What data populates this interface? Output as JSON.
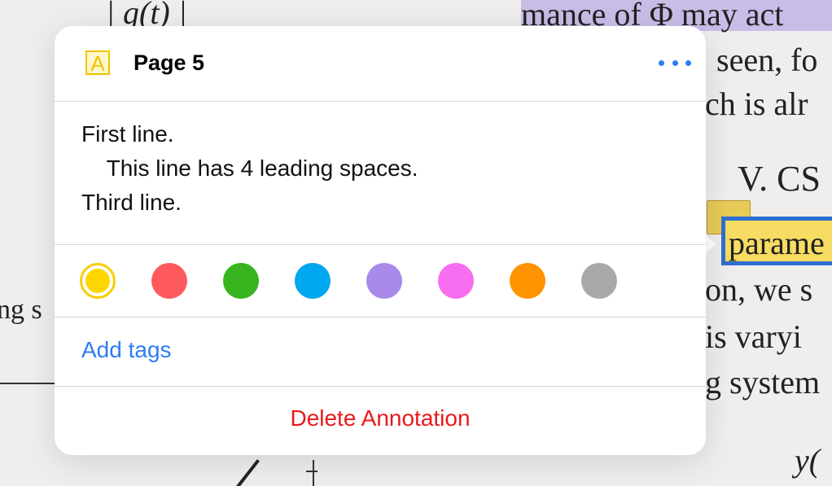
{
  "document": {
    "line_gt": "| g(t) |",
    "line1": "mance of Φ may act",
    "line2": "seen, fo",
    "line3": "ch is alr",
    "line4": "V.  CS",
    "selected_word": "parame",
    "line6": "on,  we  s",
    "line7": "is varyi",
    "line8": "g system",
    "line9": "y(",
    "left_fragment": "ng s"
  },
  "popover": {
    "type_icon": "A",
    "page_title": "Page 5",
    "more_icon": "ellipsis-icon",
    "note_text": "First line.\n    This line has 4 leading spaces.\nThird line.",
    "colors": [
      {
        "name": "yellow",
        "hex": "#ffd600",
        "selected": true
      },
      {
        "name": "red",
        "hex": "#ff5b5e",
        "selected": false
      },
      {
        "name": "green",
        "hex": "#37b41e",
        "selected": false
      },
      {
        "name": "blue",
        "hex": "#00a7ee",
        "selected": false
      },
      {
        "name": "purple",
        "hex": "#a989ea",
        "selected": false
      },
      {
        "name": "pink",
        "hex": "#f86ef0",
        "selected": false
      },
      {
        "name": "orange",
        "hex": "#ff9300",
        "selected": false
      },
      {
        "name": "gray",
        "hex": "#a9a9a9",
        "selected": false
      }
    ],
    "add_tags_label": "Add tags",
    "delete_label": "Delete Annotation"
  },
  "accent": "#2f7bf5",
  "destructive": "#e8191c"
}
